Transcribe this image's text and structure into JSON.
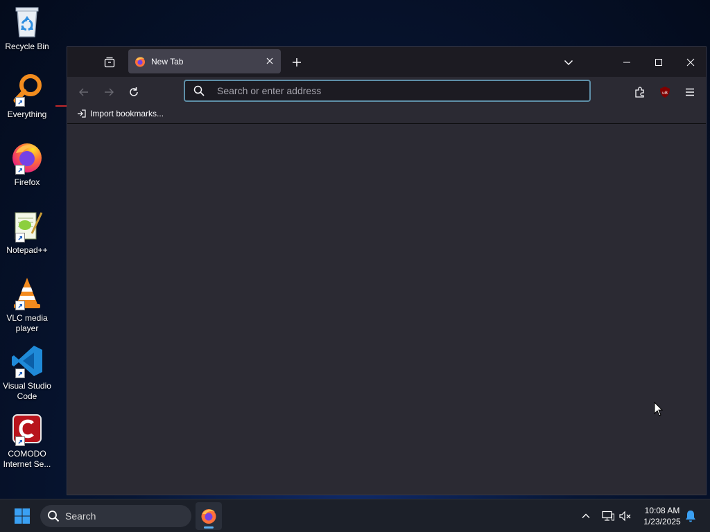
{
  "desktop": {
    "icons": [
      {
        "label": "Recycle Bin"
      },
      {
        "label": "Everything"
      },
      {
        "label": "Firefox"
      },
      {
        "label": "Notepad++"
      },
      {
        "label": "VLC media player"
      },
      {
        "label": "Visual Studio Code"
      },
      {
        "label": "COMODO Internet Se..."
      }
    ]
  },
  "browser": {
    "tab": {
      "title": "New Tab"
    },
    "urlbar": {
      "placeholder": "Search or enter address",
      "value": ""
    },
    "bookmarks": {
      "import_label": "Import bookmarks..."
    }
  },
  "taskbar": {
    "search_label": "Search",
    "clock": {
      "time": "10:08 AM",
      "date": "1/23/2025"
    }
  },
  "colors": {
    "browser_bg": "#2b2a33",
    "tabbar_bg": "#1c1b22",
    "urlbar_border": "#5e8fa8",
    "taskbar_bg": "#1c2029",
    "windows_accent": "#3aa0f3"
  }
}
